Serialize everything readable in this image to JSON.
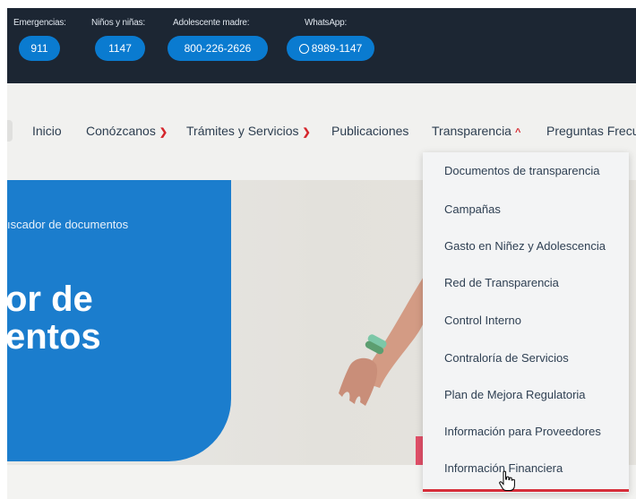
{
  "topbar": {
    "lines": [
      {
        "label": "Emergencias:",
        "number": "911"
      },
      {
        "label": "Niños y niñas:",
        "number": "1147"
      },
      {
        "label": "Adolescente madre:",
        "number": "800-226-2626"
      },
      {
        "label": "WhatsApp:",
        "number": "8989-1147",
        "icon": "whatsapp-icon"
      }
    ]
  },
  "nav": {
    "items": [
      {
        "label": "Inicio"
      },
      {
        "label": "Conózcanos",
        "chevron": "chevron-down-icon"
      },
      {
        "label": "Trámites y Servicios",
        "chevron": "chevron-down-icon"
      },
      {
        "label": "Publicaciones"
      },
      {
        "label": "Transparencia",
        "chevron": "chevron-up-icon"
      },
      {
        "label": "Preguntas Frecu"
      }
    ],
    "accent": "#d5262c"
  },
  "hero": {
    "breadcrumb": "ıscador de documentos",
    "title_line1": "or de",
    "title_line2": "entos",
    "panel_color": "#1b7dcd"
  },
  "dropdown": {
    "items": [
      "Documentos de transparencia",
      "Campañas",
      "Gasto en Niñez y Adolescencia",
      "Red de Transparencia",
      "Control Interno",
      "Contraloría de Servicios",
      "Plan de Mejora Regulatoria",
      "Información para Proveedores",
      "Información Financiera"
    ],
    "underline_color": "#d62e3a"
  }
}
